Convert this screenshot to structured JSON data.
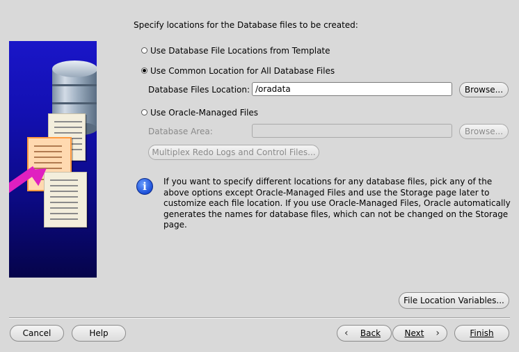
{
  "header": {
    "instruction": "Specify locations for the Database files to be created:"
  },
  "options": {
    "template": {
      "label": "Use Database File Locations from Template",
      "selected": false
    },
    "common": {
      "label": "Use Common Location for All Database Files",
      "selected": true
    },
    "omf": {
      "label": "Use Oracle-Managed Files",
      "selected": false
    }
  },
  "db_files_location": {
    "label": "Database Files Location:",
    "value": "/oradata",
    "browse_label": "Browse..."
  },
  "db_area": {
    "label": "Database Area:",
    "value": "",
    "browse_label": "Browse..."
  },
  "multiplex_button": "Multiplex Redo Logs and Control Files...",
  "info": {
    "icon": "info-icon",
    "text": "If you want to specify different locations for any database files, pick any of the above options except Oracle-Managed Files and use the Storage page later to customize each file location. If you use Oracle-Managed Files, Oracle automatically generates the names for database files, which can not be changed on the Storage page."
  },
  "file_location_variables_button": "File Location Variables...",
  "footer": {
    "cancel": "Cancel",
    "help": "Help",
    "back": "Back",
    "next": "Next",
    "finish": "Finish",
    "back_icon": "chevron-left-icon",
    "next_icon": "chevron-right-icon"
  },
  "colors": {
    "background": "#d9d9d9",
    "art_blue": "#1310b2",
    "arrow_magenta": "#e020c0",
    "info_blue": "#1c4fd8"
  }
}
